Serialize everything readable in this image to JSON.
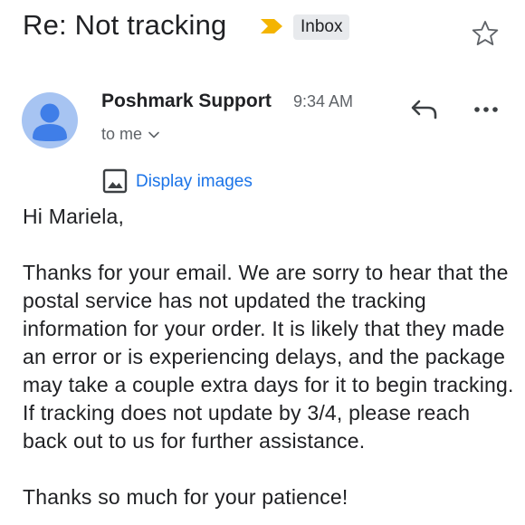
{
  "email": {
    "subject": "Re: Not tracking",
    "label": "Inbox",
    "sender_name": "Poshmark Support",
    "time": "9:34 AM",
    "recipient_line": "to me",
    "display_images_label": "Display images",
    "greeting": "Hi Mariela,",
    "paragraph": "Thanks for your email. We are sorry to hear that the postal service has not updated the tracking information for your order. It is likely that they made an error or is experiencing delays, and the package may take a couple extra days for it to begin tracking. If tracking does not update by 3/4, please reach back out to us for further assistance.",
    "closing": "Thanks so much for your patience!"
  },
  "icons": {
    "importance": "importance-marker-icon",
    "star": "star-icon",
    "avatar": "person-avatar-icon",
    "reply": "reply-icon",
    "more": "more-options-icon",
    "expand": "chevron-down-icon",
    "image": "image-icon"
  },
  "colors": {
    "importance_yellow": "#f4b400",
    "link_blue": "#1a73e8",
    "avatar_bg": "#a7c4f2",
    "avatar_fg": "#3f7ee8",
    "label_bg": "#e8eaed"
  }
}
